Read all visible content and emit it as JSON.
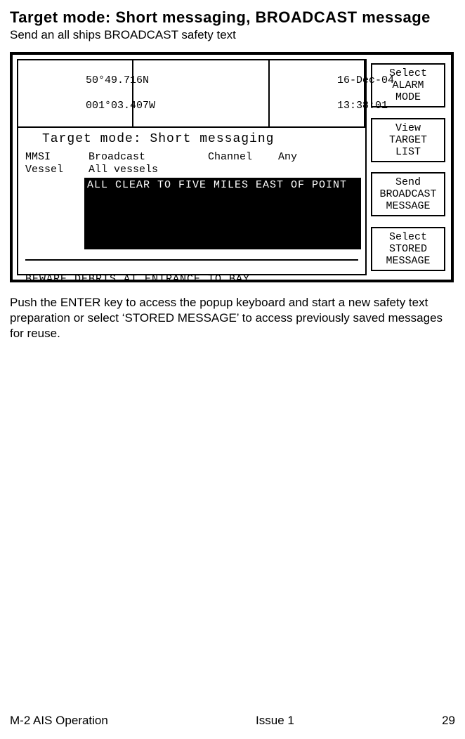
{
  "heading": {
    "title": "Target mode: Short messaging, BROADCAST message",
    "subtitle": "Send an all ships BROADCAST safety text"
  },
  "screen": {
    "coords_line1": "50°49.716N",
    "coords_line2": "001°03.407W",
    "date": "16-Dec-04",
    "time": "13:38:01",
    "mode_line": "Target mode: Short messaging",
    "field_mmsi_label": "MMSI",
    "field_mmsi_value": "Broadcast",
    "field_channel_label": "Channel",
    "field_channel_value": "Any",
    "field_vessel_label": "Vessel",
    "field_vessel_value": "All vessels",
    "compose_text": "ALL CLEAR TO FIVE MILES EAST OF POINT",
    "stored_preview": "BEWARE DEBRIS AT ENTRANCE TO BAY",
    "stored_ellipsis": "..."
  },
  "softkeys": {
    "k1": "Select\nALARM\nMODE",
    "k2": "View\nTARGET\nLIST",
    "k3": "Send\nBROADCAST\nMESSAGE",
    "k4": "Select\nSTORED\nMESSAGE"
  },
  "body": "Push the ENTER key to access the popup keyboard and start a new safety text preparation or select ‘STORED MESSAGE’ to access previously saved messages for reuse.",
  "footer": {
    "left": "M-2 AIS Operation",
    "center": "Issue 1",
    "right": "29"
  }
}
